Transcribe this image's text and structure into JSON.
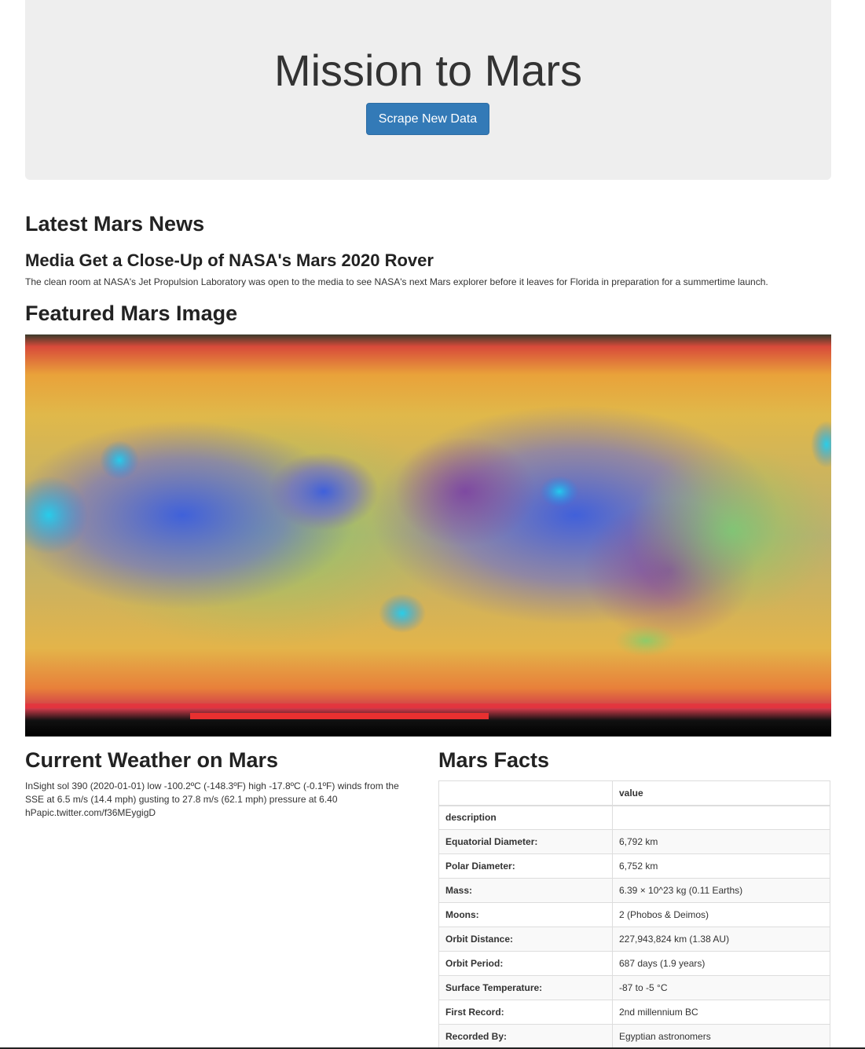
{
  "header": {
    "title": "Mission to Mars",
    "scrape_button": "Scrape New Data"
  },
  "news": {
    "section_title": "Latest Mars News",
    "headline": "Media Get a Close-Up of NASA's Mars 2020 Rover",
    "paragraph": "The clean room at NASA's Jet Propulsion Laboratory was open to the media to see NASA's next Mars explorer before it leaves for Florida in preparation for a summertime launch."
  },
  "featured": {
    "section_title": "Featured Mars Image"
  },
  "weather": {
    "section_title": "Current Weather on Mars",
    "text": "InSight sol 390 (2020-01-01) low -100.2ºC (-148.3ºF) high -17.8ºC (-0.1ºF) winds from the SSE at 6.5 m/s (14.4 mph) gusting to 27.8 m/s (62.1 mph) pressure at 6.40 hPapic.twitter.com/f36MEygigD"
  },
  "facts": {
    "section_title": "Mars Facts",
    "header": [
      "",
      "value"
    ],
    "rows": [
      [
        "description",
        ""
      ],
      [
        "Equatorial Diameter:",
        "6,792 km"
      ],
      [
        "Polar Diameter:",
        "6,752 km"
      ],
      [
        "Mass:",
        "6.39 × 10^23 kg (0.11 Earths)"
      ],
      [
        "Moons:",
        "2 (Phobos & Deimos)"
      ],
      [
        "Orbit Distance:",
        "227,943,824 km (1.38 AU)"
      ],
      [
        "Orbit Period:",
        "687 days (1.9 years)"
      ],
      [
        "Surface Temperature:",
        "-87 to -5 °C"
      ],
      [
        "First Record:",
        "2nd millennium BC"
      ],
      [
        "Recorded By:",
        "Egyptian astronomers"
      ]
    ]
  }
}
